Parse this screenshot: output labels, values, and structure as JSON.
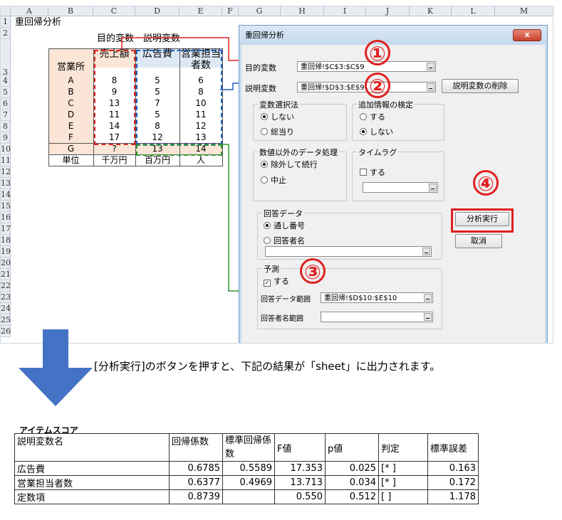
{
  "excel": {
    "columns": [
      "A",
      "B",
      "C",
      "D",
      "E",
      "F",
      "G",
      "H",
      "I",
      "J",
      "K",
      "L",
      "M"
    ],
    "rows": [
      "1",
      "2",
      "3",
      "4",
      "5",
      "6",
      "7",
      "8",
      "9",
      "10",
      "11",
      "12",
      "13",
      "14",
      "15",
      "16",
      "17",
      "18",
      "19",
      "20",
      "21",
      "22",
      "23",
      "24",
      "25",
      "26"
    ],
    "title": "重回帰分析",
    "label_objective": "目的変数",
    "label_explanatory": "説明変数",
    "header_store": "営業所",
    "header_sales": "売上額",
    "header_ad": "広告費",
    "header_staff_1": "営業担当",
    "header_staff_2": "者数",
    "data": [
      {
        "store": "A",
        "sales": "8",
        "ad": "5",
        "staff": "6"
      },
      {
        "store": "B",
        "sales": "9",
        "ad": "5",
        "staff": "8"
      },
      {
        "store": "C",
        "sales": "13",
        "ad": "7",
        "staff": "10"
      },
      {
        "store": "D",
        "sales": "11",
        "ad": "5",
        "staff": "11"
      },
      {
        "store": "E",
        "sales": "14",
        "ad": "8",
        "staff": "12"
      },
      {
        "store": "F",
        "sales": "17",
        "ad": "12",
        "staff": "13"
      },
      {
        "store": "G",
        "sales": "?",
        "ad": "13",
        "staff": "14"
      }
    ],
    "unit_label": "単位",
    "unit_sales": "千万円",
    "unit_ad": "百万円",
    "unit_staff": "人"
  },
  "dialog": {
    "title": "重回帰分析",
    "objective_label": "目的変数",
    "objective_value": "重回帰!$C$3:$C$9",
    "explanatory_label": "説明変数",
    "explanatory_value": "重回帰!$D$3:$E$9",
    "delete_button": "説明変数の削除",
    "selection_group": "変数選択法",
    "sel_opt1": "しない",
    "sel_opt2": "総当り",
    "addinfo_group": "追加情報の検定",
    "add_opt1": "する",
    "add_opt2": "しない",
    "nonnum_group": "数値以外のデータ処理",
    "nonnum_opt1": "除外して続行",
    "nonnum_opt2": "中止",
    "timelag_group": "タイムラグ",
    "timelag_opt": "する",
    "answer_group": "回答データ",
    "ans_opt1": "通し番号",
    "ans_opt2": "回答者名",
    "predict_group": "予測",
    "predict_opt": "する",
    "predict_range_label": "回答データ範囲",
    "predict_range_value": "重回帰!$D$10:$E$10",
    "respondent_label": "回答者名範囲",
    "run_button": "分析実行",
    "cancel_button": "取消",
    "close_glyph": "x"
  },
  "markers": [
    "①",
    "②",
    "③",
    "④"
  ],
  "caption": "[分析実行]のボタンを押すと、下記の結果が「sheet」に出力されます。",
  "result": {
    "title": "アイテムスコア",
    "headers": [
      "説明変数名",
      "回帰係数",
      "標準回帰係数",
      "F値",
      "p値",
      "判定",
      "標準誤差"
    ],
    "rows": [
      [
        "広告費",
        "0.6785",
        "0.5589",
        "17.353",
        "0.025",
        "[* ]",
        "0.163"
      ],
      [
        "営業担当者数",
        "0.6377",
        "0.4969",
        "13.713",
        "0.034",
        "[* ]",
        "0.172"
      ],
      [
        "定数項",
        "0.8739",
        "",
        "0.550",
        "0.512",
        "[ ]",
        "1.178"
      ]
    ]
  },
  "colors": {
    "red": "#e02020",
    "blue": "#1f5fbf",
    "green": "#2e9a2e",
    "orange_fill": "#fbe5d6",
    "blue_fill": "#dde9f5",
    "arrow": "#4472c4"
  }
}
